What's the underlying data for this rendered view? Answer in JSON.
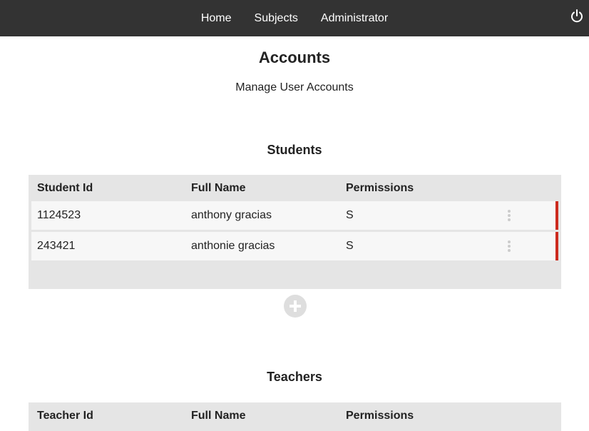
{
  "nav": {
    "links": [
      "Home",
      "Subjects",
      "Administrator"
    ],
    "power_icon": "power-icon"
  },
  "page": {
    "title": "Accounts",
    "subtitle": "Manage User Accounts"
  },
  "students": {
    "title": "Students",
    "columns": [
      "Student Id",
      "Full Name",
      "Permissions"
    ],
    "rows": [
      {
        "id": "1124523",
        "name": "anthony gracias",
        "permissions": "S"
      },
      {
        "id": "243421",
        "name": "anthonie gracias",
        "permissions": "S"
      }
    ],
    "add_icon": "plus-circle-icon"
  },
  "teachers": {
    "title": "Teachers",
    "columns": [
      "Teacher Id",
      "Full Name",
      "Permissions"
    ]
  },
  "colors": {
    "navbar": "#333333",
    "table_bg": "#e5e5e5",
    "row_bg": "#f7f7f7",
    "accent_red": "#cc2a1e"
  }
}
